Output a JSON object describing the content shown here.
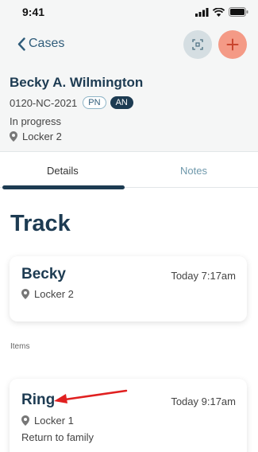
{
  "status_bar": {
    "time": "9:41"
  },
  "header": {
    "back_label": "Cases",
    "person_name": "Becky A. Wilmington",
    "case_number": "0120-NC-2021",
    "badges": [
      "PN",
      "AN"
    ],
    "status": "In progress",
    "location": "Locker 2"
  },
  "tabs": [
    {
      "label": "Details",
      "active": true
    },
    {
      "label": "Notes",
      "active": false
    }
  ],
  "main": {
    "heading": "Track",
    "cards": [
      {
        "title": "Becky",
        "time": "Today 7:17am",
        "location": "Locker 2"
      }
    ],
    "items_label": "Items",
    "items": [
      {
        "title": "Ring",
        "time": "Today 9:17am",
        "location": "Locker 1",
        "note": "Return to family"
      }
    ]
  },
  "colors": {
    "primary": "#1d3b52",
    "accent": "#f49a86",
    "scan_bg": "#d5dee2",
    "annotation_arrow": "#e02020"
  },
  "icons": [
    "back-chevron-icon",
    "scan-icon",
    "plus-icon",
    "location-pin-icon",
    "signal-icon",
    "wifi-icon",
    "battery-icon"
  ]
}
